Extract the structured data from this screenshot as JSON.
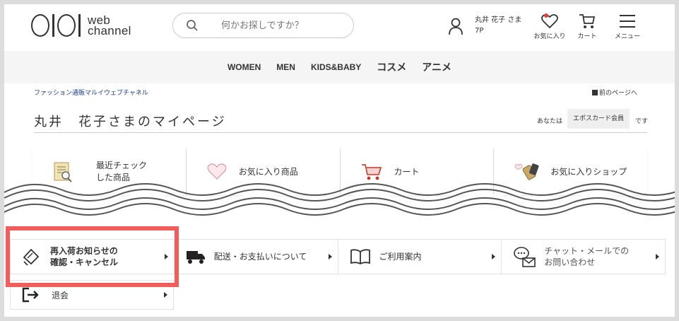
{
  "logo": {
    "text_line1": "web",
    "text_line2": "channel"
  },
  "search": {
    "placeholder": "何かお探しですか？"
  },
  "user": {
    "name": "丸井 花子 さま",
    "points": "7P"
  },
  "header_icons": {
    "favorites": "お気に入り",
    "cart": "カート",
    "menu": "メニュー"
  },
  "nav": {
    "items": [
      "WOMEN",
      "MEN",
      "KIDS&BABY",
      "コスメ",
      "アニメ"
    ]
  },
  "breadcrumb": "ファッション通販マルイウェブチャネル",
  "back_link": "前のページへ",
  "page_title": "丸井　花子さまのマイページ",
  "membership": {
    "label": "あなたは",
    "value": "エポスカード会員",
    "suffix": "です"
  },
  "tiles": [
    {
      "label_line1": "最近チェック",
      "label_line2": "した商品",
      "icon": "recent-list-icon"
    },
    {
      "label_line1": "お気に入り商品",
      "label_line2": "",
      "icon": "heart-icon"
    },
    {
      "label_line1": "カート",
      "label_line2": "",
      "icon": "cart-icon"
    },
    {
      "label_line1": "お気に入りショップ",
      "label_line2": "",
      "icon": "shop-tag-icon"
    }
  ],
  "menu_row": [
    {
      "label_line1": "再入荷お知らせの",
      "label_line2": "確認・キャンセル",
      "icon": "ticket-icon"
    },
    {
      "label_line1": "配送・お支払いについて",
      "label_line2": "",
      "icon": "truck-icon"
    },
    {
      "label_line1": "ご利用案内",
      "label_line2": "",
      "icon": "book-icon"
    },
    {
      "label_line1": "チャット・メールでの",
      "label_line2": "お問い合わせ",
      "icon": "chat-mail-icon"
    }
  ],
  "withdraw": {
    "label": "退会",
    "icon": "logout-icon"
  },
  "colors": {
    "highlight": "#f25c5c",
    "favorite_dot": "#e83a3a",
    "nav_bg": "#f5f5f5"
  }
}
